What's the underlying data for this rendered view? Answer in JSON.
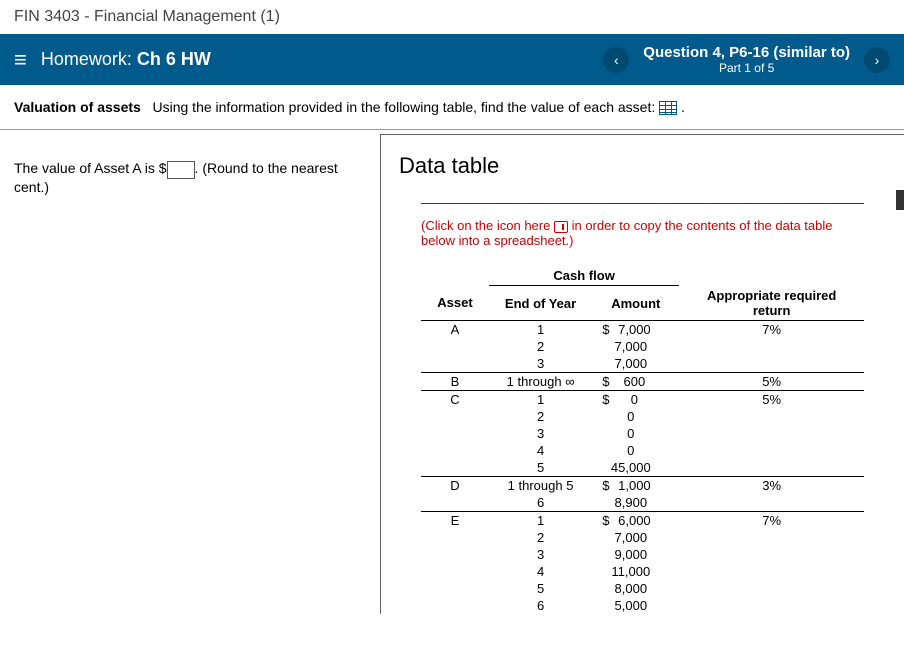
{
  "course": "FIN 3403 - Financial Management (1)",
  "hw": {
    "label": "Homework:",
    "name": "Ch 6 HW"
  },
  "question": {
    "title": "Question 4, P6-16 (similar to)",
    "part": "Part 1 of 5"
  },
  "instruction": {
    "bold": "Valuation of assets",
    "rest": "Using the information provided in the following table, find the value of each asset:"
  },
  "answer": {
    "pre": "The value of Asset A is $",
    "value": "",
    "post": ". (Round to the nearest cent.)"
  },
  "datatable": {
    "title": "Data table",
    "hint1": "(Click on the icon here",
    "hint2": "in order to copy the contents of the data table below into a spreadsheet.)",
    "cashflow_header": "Cash flow",
    "headers": {
      "asset": "Asset",
      "eoy": "End of Year",
      "amount": "Amount",
      "return": "Appropriate required return"
    },
    "rows": [
      {
        "asset": "A",
        "eoy": "1",
        "dollar": "$",
        "amount": "7,000",
        "return": "7%",
        "top": true
      },
      {
        "asset": "",
        "eoy": "2",
        "dollar": "",
        "amount": "7,000",
        "return": ""
      },
      {
        "asset": "",
        "eoy": "3",
        "dollar": "",
        "amount": "7,000",
        "return": ""
      },
      {
        "asset": "B",
        "eoy": "1 through ∞",
        "dollar": "$",
        "amount": "600",
        "return": "5%",
        "top": true
      },
      {
        "asset": "C",
        "eoy": "1",
        "dollar": "$",
        "amount": "0",
        "return": "5%",
        "top": true
      },
      {
        "asset": "",
        "eoy": "2",
        "dollar": "",
        "amount": "0",
        "return": ""
      },
      {
        "asset": "",
        "eoy": "3",
        "dollar": "",
        "amount": "0",
        "return": ""
      },
      {
        "asset": "",
        "eoy": "4",
        "dollar": "",
        "amount": "0",
        "return": ""
      },
      {
        "asset": "",
        "eoy": "5",
        "dollar": "",
        "amount": "45,000",
        "return": ""
      },
      {
        "asset": "D",
        "eoy": "1 through 5",
        "dollar": "$",
        "amount": "1,000",
        "return": "3%",
        "top": true
      },
      {
        "asset": "",
        "eoy": "6",
        "dollar": "",
        "amount": "8,900",
        "return": ""
      },
      {
        "asset": "E",
        "eoy": "1",
        "dollar": "$",
        "amount": "6,000",
        "return": "7%",
        "top": true
      },
      {
        "asset": "",
        "eoy": "2",
        "dollar": "",
        "amount": "7,000",
        "return": ""
      },
      {
        "asset": "",
        "eoy": "3",
        "dollar": "",
        "amount": "9,000",
        "return": ""
      },
      {
        "asset": "",
        "eoy": "4",
        "dollar": "",
        "amount": "11,000",
        "return": ""
      },
      {
        "asset": "",
        "eoy": "5",
        "dollar": "",
        "amount": "8,000",
        "return": ""
      },
      {
        "asset": "",
        "eoy": "6",
        "dollar": "",
        "amount": "5,000",
        "return": ""
      }
    ]
  },
  "chart_data": {
    "type": "table",
    "title": "Cash flow data table for asset valuation",
    "columns": [
      "Asset",
      "End of Year",
      "Amount",
      "Appropriate required return"
    ],
    "assets": [
      {
        "name": "A",
        "required_return": 0.07,
        "cashflows": [
          {
            "year": 1,
            "amount": 7000
          },
          {
            "year": 2,
            "amount": 7000
          },
          {
            "year": 3,
            "amount": 7000
          }
        ]
      },
      {
        "name": "B",
        "required_return": 0.05,
        "cashflows": [
          {
            "year": "1 through ∞",
            "amount": 600
          }
        ]
      },
      {
        "name": "C",
        "required_return": 0.05,
        "cashflows": [
          {
            "year": 1,
            "amount": 0
          },
          {
            "year": 2,
            "amount": 0
          },
          {
            "year": 3,
            "amount": 0
          },
          {
            "year": 4,
            "amount": 0
          },
          {
            "year": 5,
            "amount": 45000
          }
        ]
      },
      {
        "name": "D",
        "required_return": 0.03,
        "cashflows": [
          {
            "year": "1 through 5",
            "amount": 1000
          },
          {
            "year": 6,
            "amount": 8900
          }
        ]
      },
      {
        "name": "E",
        "required_return": 0.07,
        "cashflows": [
          {
            "year": 1,
            "amount": 6000
          },
          {
            "year": 2,
            "amount": 7000
          },
          {
            "year": 3,
            "amount": 9000
          },
          {
            "year": 4,
            "amount": 11000
          },
          {
            "year": 5,
            "amount": 8000
          },
          {
            "year": 6,
            "amount": 5000
          }
        ]
      }
    ]
  }
}
